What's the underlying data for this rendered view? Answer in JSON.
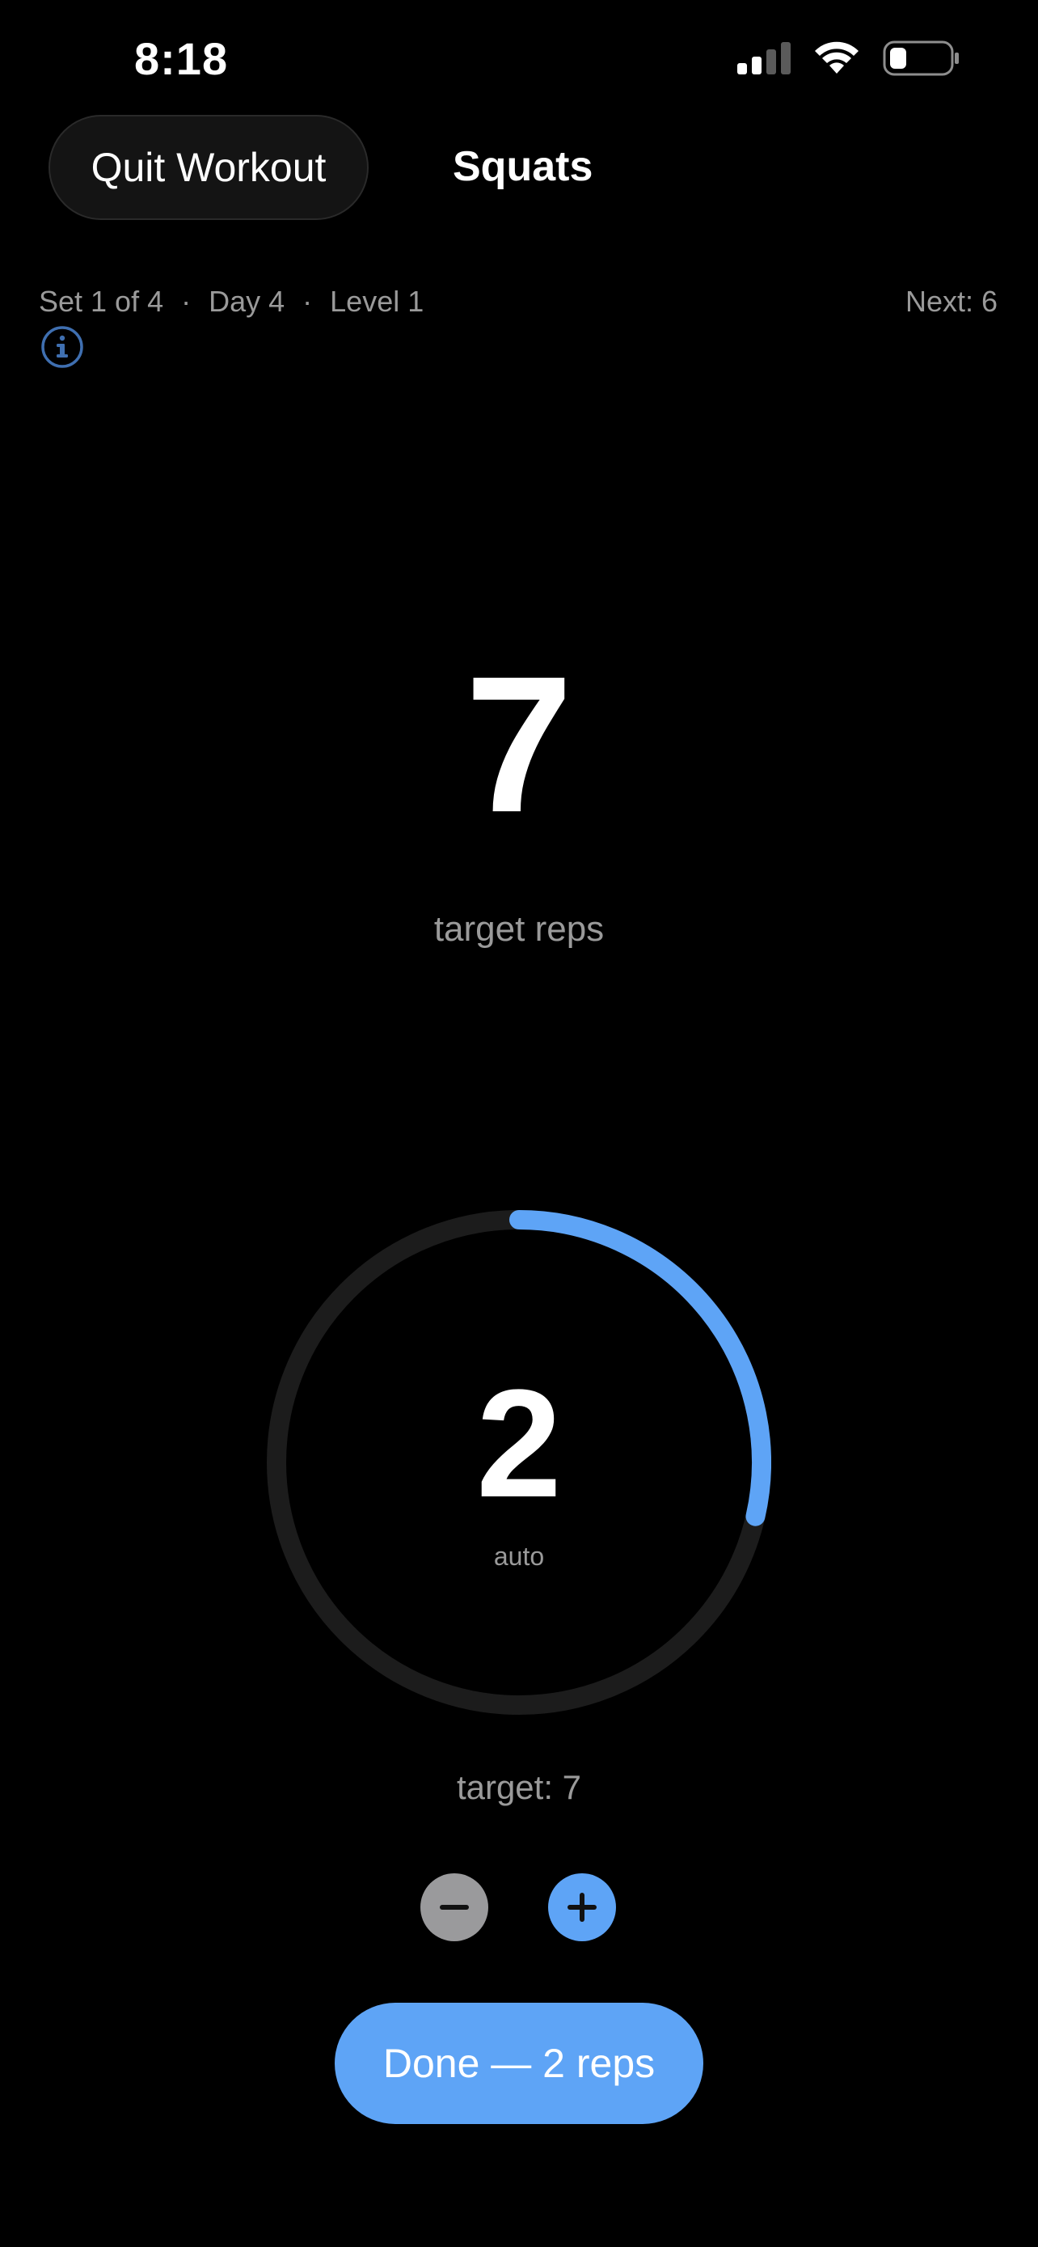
{
  "status_bar": {
    "time": "8:18"
  },
  "header": {
    "quit_label": "Quit Workout",
    "title": "Squats"
  },
  "meta": {
    "set": "Set 1 of 4",
    "day": "Day 4",
    "level": "Level 1",
    "separator": "·",
    "next": "Next: 6"
  },
  "target": {
    "reps": "7",
    "caption": "target reps"
  },
  "counter": {
    "count": "2",
    "mode": "auto",
    "target_text": "target: 7",
    "progress_fraction": 0.2857
  },
  "done_button": {
    "label": "Done — 2 reps"
  },
  "colors": {
    "background": "#000000",
    "accent": "#5ea4f6",
    "ring_track": "#1c1c1c",
    "muted_text": "#9a9a9a",
    "minus_button": "#9a9a9c",
    "info_icon": "#3f6fb0"
  },
  "icons": {
    "signal": "cellular-signal-icon",
    "wifi": "wifi-icon",
    "battery": "battery-icon",
    "info": "info-icon",
    "minus": "minus-icon",
    "plus": "plus-icon"
  }
}
